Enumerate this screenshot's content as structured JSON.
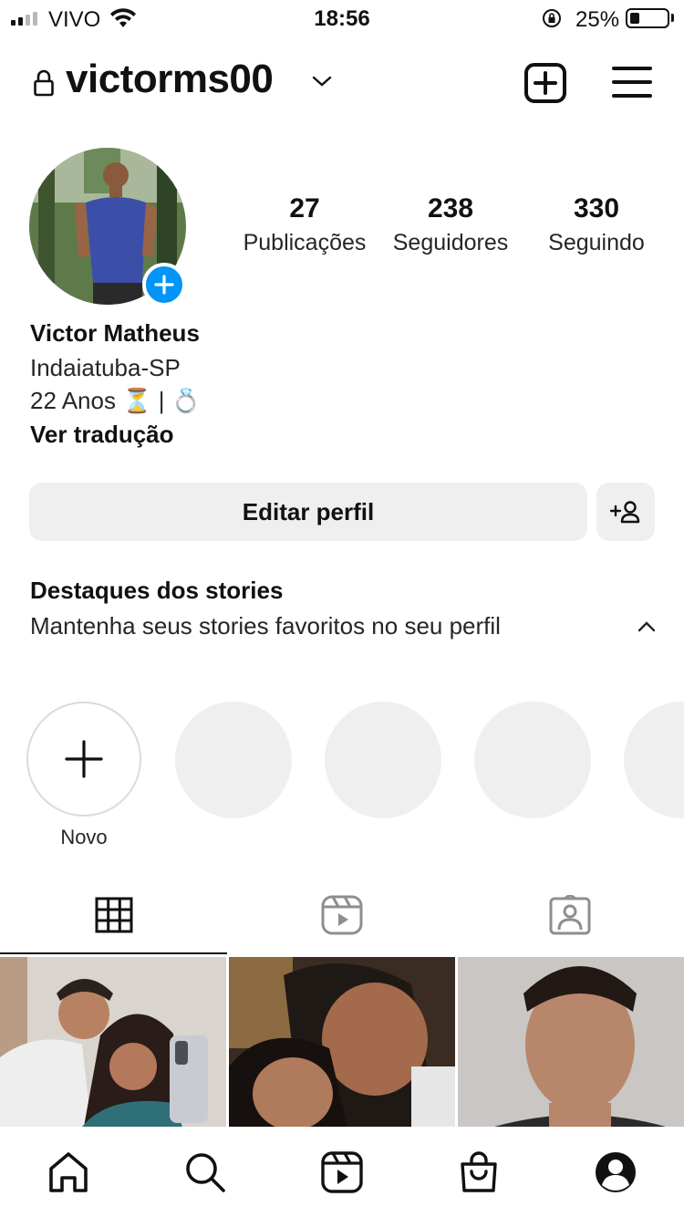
{
  "status_bar": {
    "carrier": "VIVO",
    "time": "18:56",
    "battery_percent": "25%",
    "battery_level": 0.25,
    "signal_bars": 2
  },
  "header": {
    "username": "victorms00",
    "icons": [
      "lock-icon",
      "chevron-down-icon",
      "new-post-icon",
      "menu-icon"
    ]
  },
  "profile": {
    "stats": [
      {
        "value": "27",
        "label": "Publicações"
      },
      {
        "value": "238",
        "label": "Seguidores"
      },
      {
        "value": "330",
        "label": "Seguindo"
      }
    ],
    "name": "Victor Matheus",
    "bio_lines": [
      "Indaiatuba-SP",
      "22 Anos ⏳ | 💍"
    ],
    "translate_label": "Ver tradução"
  },
  "actions": {
    "edit_profile_label": "Editar perfil",
    "suggest_icon": "add-person-icon"
  },
  "highlights": {
    "title": "Destaques dos stories",
    "description": "Mantenha seus stories favoritos no seu perfil",
    "new_label": "Novo",
    "empty_slots": 4
  },
  "tabs": [
    "grid-icon",
    "reels-icon",
    "tagged-icon"
  ],
  "bottom_nav": [
    "home-icon",
    "search-icon",
    "reels-icon",
    "shop-icon",
    "profile-icon"
  ],
  "colors": {
    "accent": "#0095f6",
    "button_bg": "#efefef",
    "text": "#262626"
  }
}
